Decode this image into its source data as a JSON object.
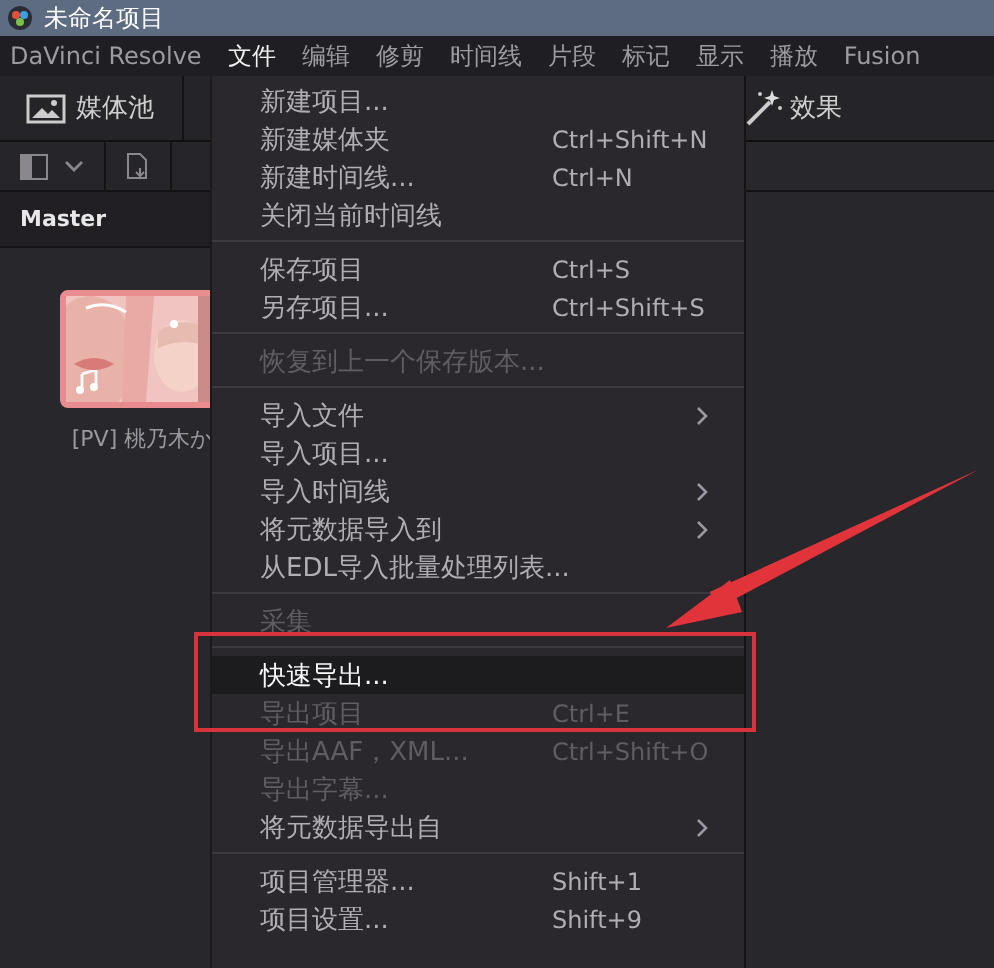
{
  "window": {
    "title": "未命名项目"
  },
  "menubar": [
    {
      "label": "DaVinci Resolve",
      "selected": false
    },
    {
      "label": "文件",
      "selected": true
    },
    {
      "label": "编辑",
      "selected": false
    },
    {
      "label": "修剪",
      "selected": false
    },
    {
      "label": "时间线",
      "selected": false
    },
    {
      "label": "片段",
      "selected": false
    },
    {
      "label": "标记",
      "selected": false
    },
    {
      "label": "显示",
      "selected": false
    },
    {
      "label": "播放",
      "selected": false
    },
    {
      "label": "Fusion",
      "selected": false
    }
  ],
  "toolbar": {
    "media_pool": "媒体池",
    "effects": "效果"
  },
  "bin": {
    "header": "Master",
    "clips": [
      {
        "name": "[PV] 桃乃木か",
        "kind": "picture"
      }
    ]
  },
  "file_menu": [
    {
      "kind": "item",
      "label": "新建项目...",
      "disabled": false,
      "submenu": false,
      "selected": false
    },
    {
      "kind": "item",
      "label": "新建媒体夹",
      "shortcut": "Ctrl+Shift+N",
      "disabled": false,
      "submenu": false,
      "selected": false
    },
    {
      "kind": "item",
      "label": "新建时间线...",
      "shortcut": "Ctrl+N",
      "disabled": false,
      "submenu": false,
      "selected": false
    },
    {
      "kind": "item",
      "label": "关闭当前时间线",
      "disabled": false,
      "submenu": false,
      "selected": false
    },
    {
      "kind": "separator"
    },
    {
      "kind": "item",
      "label": "保存项目",
      "shortcut": "Ctrl+S",
      "disabled": false,
      "submenu": false,
      "selected": false
    },
    {
      "kind": "item",
      "label": "另存项目...",
      "shortcut": "Ctrl+Shift+S",
      "disabled": false,
      "submenu": false,
      "selected": false
    },
    {
      "kind": "separator"
    },
    {
      "kind": "item",
      "label": "恢复到上一个保存版本...",
      "disabled": true,
      "submenu": false,
      "selected": false
    },
    {
      "kind": "separator"
    },
    {
      "kind": "item",
      "label": "导入文件",
      "disabled": false,
      "submenu": true,
      "selected": false
    },
    {
      "kind": "item",
      "label": "导入项目...",
      "disabled": false,
      "submenu": false,
      "selected": false
    },
    {
      "kind": "item",
      "label": "导入时间线",
      "disabled": false,
      "submenu": true,
      "selected": false
    },
    {
      "kind": "item",
      "label": "将元数据导入到",
      "disabled": false,
      "submenu": true,
      "selected": false
    },
    {
      "kind": "item",
      "label": "从EDL导入批量处理列表...",
      "disabled": false,
      "submenu": false,
      "selected": false
    },
    {
      "kind": "separator"
    },
    {
      "kind": "item",
      "label": "采集",
      "disabled": true,
      "submenu": false,
      "selected": false
    },
    {
      "kind": "separator"
    },
    {
      "kind": "item",
      "label": "快速导出...",
      "disabled": false,
      "submenu": false,
      "selected": true
    },
    {
      "kind": "item",
      "label": "导出项目",
      "shortcut": "Ctrl+E",
      "disabled": true,
      "submenu": false,
      "selected": false
    },
    {
      "kind": "item",
      "label": "导出AAF，XML...",
      "shortcut": "Ctrl+Shift+O",
      "disabled": true,
      "submenu": false,
      "selected": false
    },
    {
      "kind": "item",
      "label": "导出字幕...",
      "disabled": true,
      "submenu": false,
      "selected": false
    },
    {
      "kind": "item",
      "label": "将元数据导出自",
      "disabled": false,
      "submenu": true,
      "selected": false
    },
    {
      "kind": "separator"
    },
    {
      "kind": "item",
      "label": "项目管理器...",
      "shortcut": "Shift+1",
      "disabled": false,
      "submenu": false,
      "selected": false
    },
    {
      "kind": "item",
      "label": "项目设置...",
      "shortcut": "Shift+9",
      "disabled": false,
      "submenu": false,
      "selected": false
    }
  ],
  "callout": {
    "frame": true,
    "arrow": true
  }
}
